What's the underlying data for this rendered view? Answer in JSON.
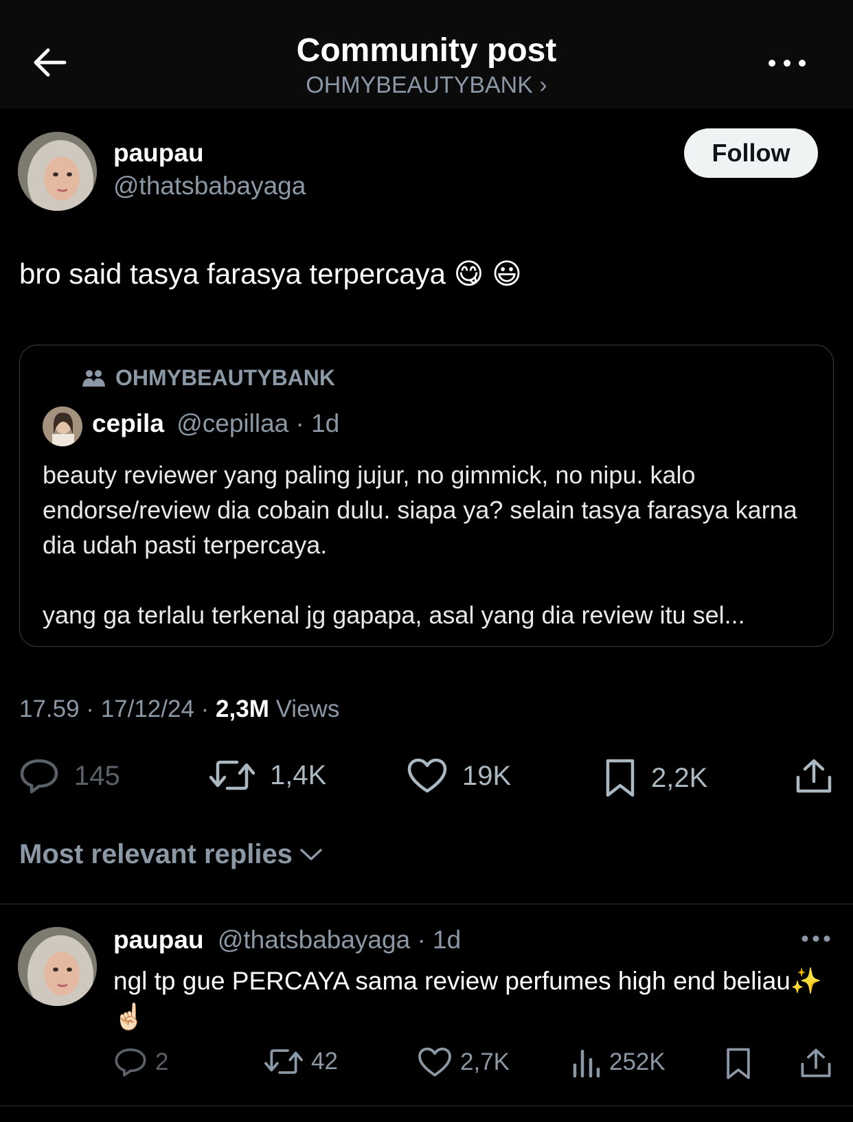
{
  "header": {
    "title": "Community post",
    "subtitle": "OHMYBEAUTYBANK ›"
  },
  "post": {
    "author_name": "paupau",
    "author_handle": "@thatsbabayaga",
    "follow_label": "Follow",
    "text": "bro said tasya farasya terpercaya 😋 😃",
    "quote": {
      "community": "OHMYBEAUTYBANK",
      "author_name": "cepila",
      "author_handle": "@cepillaa",
      "time": "· 1d",
      "text": "beauty reviewer yang paling jujur, no gimmick, no nipu. kalo endorse/review dia cobain dulu. siapa ya? selain tasya farasya karna dia udah pasti terpercaya.\n\nyang ga terlalu terkenal jg gapapa, asal yang dia review itu sel..."
    },
    "meta": {
      "time_date": "17.59 · 17/12/24 · ",
      "views_count": "2,3M",
      "views_label": "Views"
    },
    "stats": {
      "replies": "145",
      "reposts": "1,4K",
      "likes": "19K",
      "bookmarks": "2,2K"
    }
  },
  "replies_sort_label": "Most relevant replies",
  "reply": {
    "author_name": "paupau",
    "author_handle": "@thatsbabayaga",
    "time": "· 1d",
    "text": "ngl tp gue PERCAYA sama review perfumes high end beliau✨ ☝🏻",
    "stats": {
      "replies": "2",
      "reposts": "42",
      "likes": "2,7K",
      "views": "252K"
    }
  },
  "colors": {
    "background": "#000000",
    "header_bg": "#0b0b0b",
    "secondary_text": "#8b98a5",
    "border": "#2f3336"
  }
}
